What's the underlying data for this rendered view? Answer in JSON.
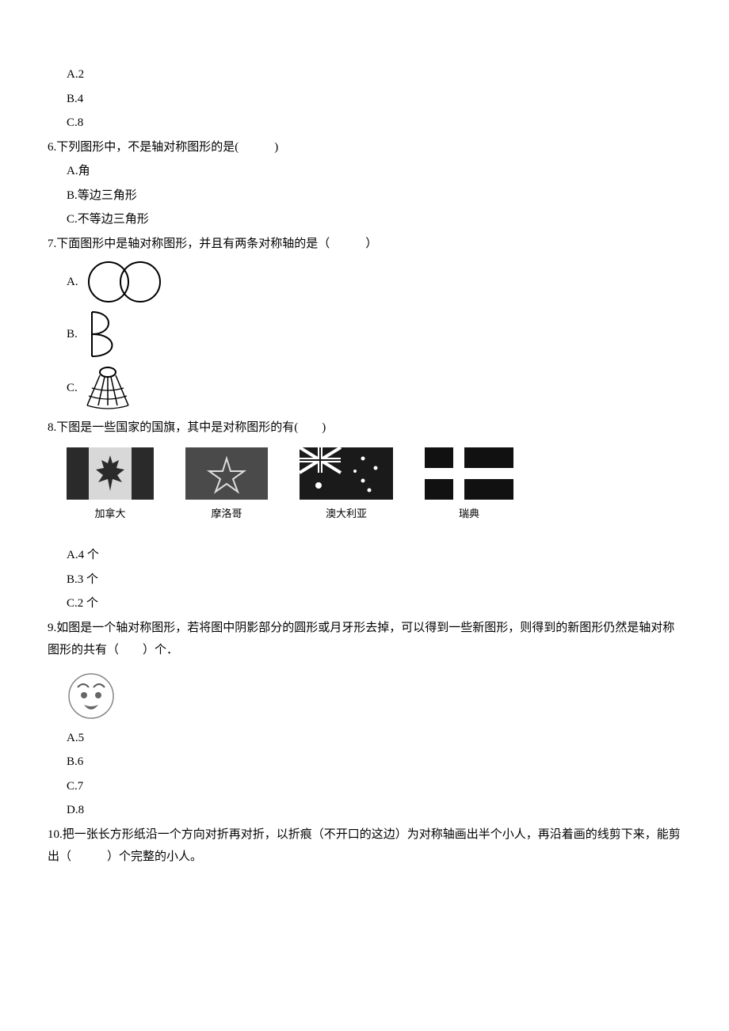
{
  "q5": {
    "options": {
      "a": "A.2",
      "b": "B.4",
      "c": "C.8"
    }
  },
  "q6": {
    "stem": "6.下列图形中，不是轴对称图形的是(　　　)",
    "options": {
      "a": "A.角",
      "b": "B.等边三角形",
      "c": "C.不等边三角形"
    }
  },
  "q7": {
    "stem": "7.下面图形中是轴对称图形，并且有两条对称轴的是（　　　）",
    "options": {
      "a": "A.",
      "b": "B.",
      "c": "C."
    }
  },
  "q8": {
    "stem": "8.下图是一些国家的国旗，其中是对称图形的有(　　)",
    "flags": {
      "canada": "加拿大",
      "morocco": "摩洛哥",
      "australia": "澳大利亚",
      "sweden": "瑞典"
    },
    "options": {
      "a": "A.4 个",
      "b": "B.3 个",
      "c": "C.2 个"
    }
  },
  "q9": {
    "stem": "9.如图是一个轴对称图形，若将图中阴影部分的圆形或月牙形去掉，可以得到一些新图形，则得到的新图形仍然是轴对称图形的共有（　　）个．",
    "options": {
      "a": "A.5",
      "b": "B.6",
      "c": "C.7",
      "d": "D.8"
    }
  },
  "q10": {
    "stem": "10.把一张长方形纸沿一个方向对折再对折，以折痕（不开口的这边）为对称轴画出半个小人，再沿着画的线剪下来，能剪出（　　　）个完整的小人。"
  }
}
